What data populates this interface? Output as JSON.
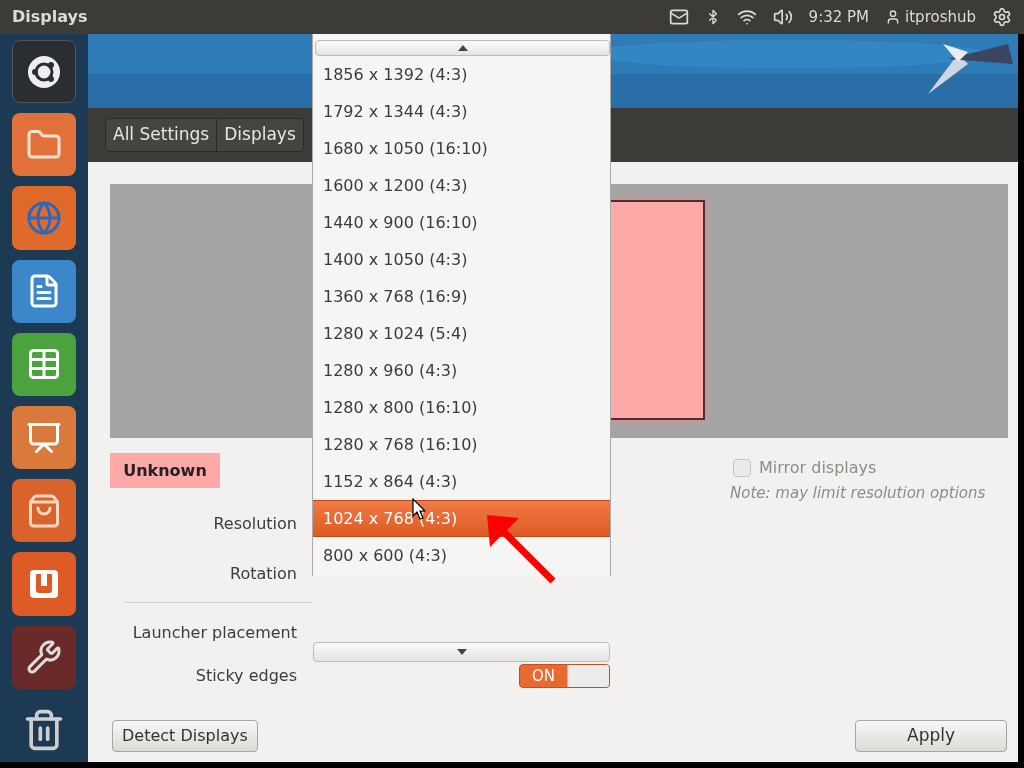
{
  "top_bar": {
    "title": "Displays",
    "time": "9:32 PM",
    "user": "itproshub"
  },
  "launcher": [
    {
      "kind": "dash"
    },
    {
      "kind": "folder"
    },
    {
      "kind": "browser"
    },
    {
      "kind": "document"
    },
    {
      "kind": "spreadsheet"
    },
    {
      "kind": "presentation"
    },
    {
      "kind": "bag"
    },
    {
      "kind": "cloud"
    },
    {
      "kind": "settings"
    },
    {
      "kind": "trash"
    }
  ],
  "breadcrumbs": [
    "All Settings",
    "Displays"
  ],
  "monitor": {
    "label": "Unknown"
  },
  "resolution_menu": [
    {
      "label": "1856 x 1392 (4:3)",
      "selected": false
    },
    {
      "label": "1792 x 1344 (4:3)",
      "selected": false
    },
    {
      "label": "1680 x 1050 (16:10)",
      "selected": false
    },
    {
      "label": "1600 x 1200 (4:3)",
      "selected": false
    },
    {
      "label": "1440 x 900 (16:10)",
      "selected": false
    },
    {
      "label": "1400 x 1050 (4:3)",
      "selected": false
    },
    {
      "label": "1360 x 768 (16:9)",
      "selected": false
    },
    {
      "label": "1280 x 1024 (5:4)",
      "selected": false
    },
    {
      "label": "1280 x 960 (4:3)",
      "selected": false
    },
    {
      "label": "1280 x 800 (16:10)",
      "selected": false
    },
    {
      "label": "1280 x 768 (16:10)",
      "selected": false
    },
    {
      "label": "1152 x 864 (4:3)",
      "selected": false
    },
    {
      "label": "1024 x 768 (4:3)",
      "selected": true
    },
    {
      "label": "800 x 600 (4:3)",
      "selected": false
    }
  ],
  "form": {
    "resolution_label": "Resolution",
    "rotation_label": "Rotation",
    "launcher_label": "Launcher placement",
    "sticky_label": "Sticky edges",
    "sticky_on": true,
    "sticky_on_text": "ON"
  },
  "mirror": {
    "label": "Mirror displays",
    "checked": false,
    "disabled": true,
    "note": "Note: may limit resolution options"
  },
  "buttons": {
    "detect": "Detect Displays",
    "apply": "Apply"
  }
}
